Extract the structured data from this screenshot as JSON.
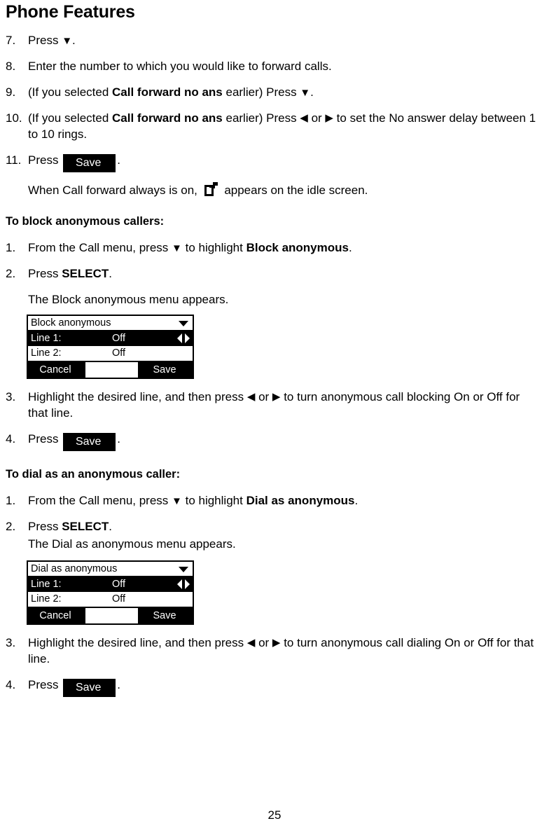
{
  "document": {
    "title": "Phone Features",
    "page_number": "25"
  },
  "icons": {
    "arrow_down": "▼",
    "arrow_left": "◀",
    "arrow_right": "▶",
    "caret_down": "caret-down-icon",
    "call_forward": "call-forward-icon"
  },
  "softkey": {
    "save_label": "Save"
  },
  "call_forward_steps": [
    {
      "num": "7.",
      "parts": [
        {
          "type": "text",
          "value": "Press "
        },
        {
          "type": "arrow",
          "value": "▼"
        },
        {
          "type": "text",
          "value": "."
        }
      ],
      "plain": "Press ▼."
    },
    {
      "num": "8.",
      "plain": "Enter the number to which you would like to forward calls."
    },
    {
      "num": "9.",
      "plain": "(If you selected Call forward no ans earlier) Press ▼.",
      "pre": "(If you selected ",
      "bold": "Call forward no ans",
      "post": " earlier) Press ",
      "tail": "."
    },
    {
      "num": "10.",
      "plain": "(If you selected Call forward no ans earlier) Press ◀ or ▶ to set the No answer delay between 1 to 10 rings.",
      "pre": "(If you selected ",
      "bold": "Call forward no ans",
      "post": " earlier) Press ",
      "mid": " or ",
      "tail": " to set the No answer delay between 1 to 10 rings."
    },
    {
      "num": "11.",
      "pre": "Press ",
      "tail": "."
    }
  ],
  "call_forward_note": {
    "pre": "When Call forward always is on, ",
    "post": " appears on the idle screen."
  },
  "block_section": {
    "heading": "To block anonymous callers:",
    "steps": [
      {
        "num": "1.",
        "pre": "From the Call menu, press ",
        "mid": " to highlight ",
        "bold": "Block anonymous",
        "tail": "."
      },
      {
        "num": "2.",
        "pre": "Press ",
        "bold": "SELECT",
        "tail": "."
      }
    ],
    "menu_appears": "The Block anonymous menu appears.",
    "step3": {
      "num": "3.",
      "pre": "Highlight the desired line, and then press ",
      "mid": " or ",
      "tail": " to turn anonymous call blocking On or Off for that line."
    },
    "step4": {
      "num": "4.",
      "pre": "Press ",
      "tail": "."
    },
    "lcd": {
      "title": "Block anonymous",
      "rows": [
        {
          "label": "Line 1:",
          "value": "Off",
          "selected": true
        },
        {
          "label": "Line 2:",
          "value": "Off",
          "selected": false
        }
      ],
      "softkey_left": "Cancel",
      "softkey_right": "Save"
    }
  },
  "dial_section": {
    "heading": "To dial as an anonymous caller:",
    "steps": [
      {
        "num": "1.",
        "pre": "From the Call menu, press ",
        "mid": " to highlight ",
        "bold": "Dial as anonymous",
        "tail": "."
      },
      {
        "num": "2.",
        "pre": "Press ",
        "bold": "SELECT",
        "tail": "."
      }
    ],
    "menu_appears": "The Dial as anonymous menu appears.",
    "step3": {
      "num": "3.",
      "pre": "Highlight the desired line, and then press ",
      "mid": " or ",
      "tail": " to turn anonymous call dialing On or Off for that line."
    },
    "step4": {
      "num": "4.",
      "pre": "Press ",
      "tail": "."
    },
    "lcd": {
      "title": "Dial as anonymous",
      "rows": [
        {
          "label": "Line 1:",
          "value": "Off",
          "selected": true
        },
        {
          "label": "Line 2:",
          "value": "Off",
          "selected": false
        }
      ],
      "softkey_left": "Cancel",
      "softkey_right": "Save"
    }
  }
}
